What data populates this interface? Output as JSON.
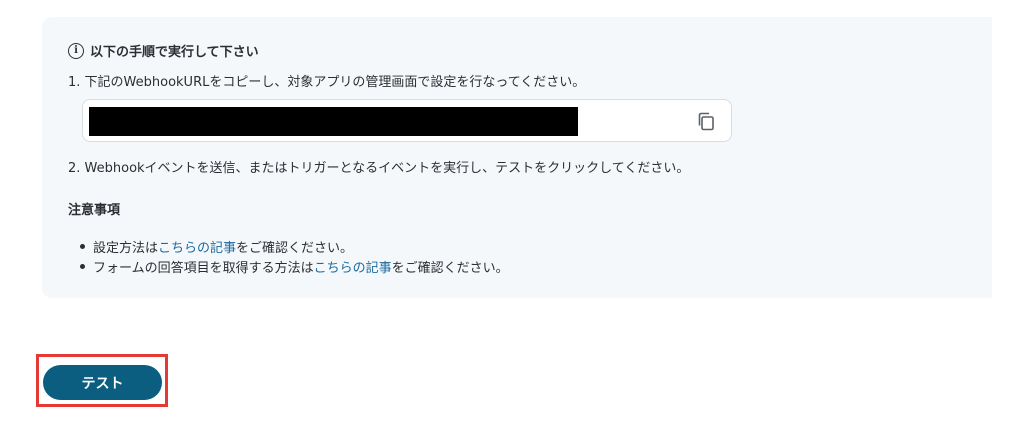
{
  "instructions": {
    "heading": "以下の手順で実行して下さい",
    "step1": "1. 下記のWebhookURLをコピーし、対象アプリの管理画面で設定を行なってください。",
    "step2": "2. Webhookイベントを送信、またはトリガーとなるイベントを実行し、テストをクリックしてください。"
  },
  "notes": {
    "title": "注意事項",
    "items": [
      {
        "prefix": "設定方法は",
        "link": "こちらの記事",
        "suffix": "をご確認ください。"
      },
      {
        "prefix": "フォームの回答項目を取得する方法は",
        "link": "こちらの記事",
        "suffix": "をご確認ください。"
      }
    ]
  },
  "actions": {
    "test_label": "テスト"
  },
  "colors": {
    "panel_bg": "#f5f8fb",
    "link": "#1a6aa0",
    "primary_button": "#0b5e80",
    "highlight_border": "#e53935"
  }
}
